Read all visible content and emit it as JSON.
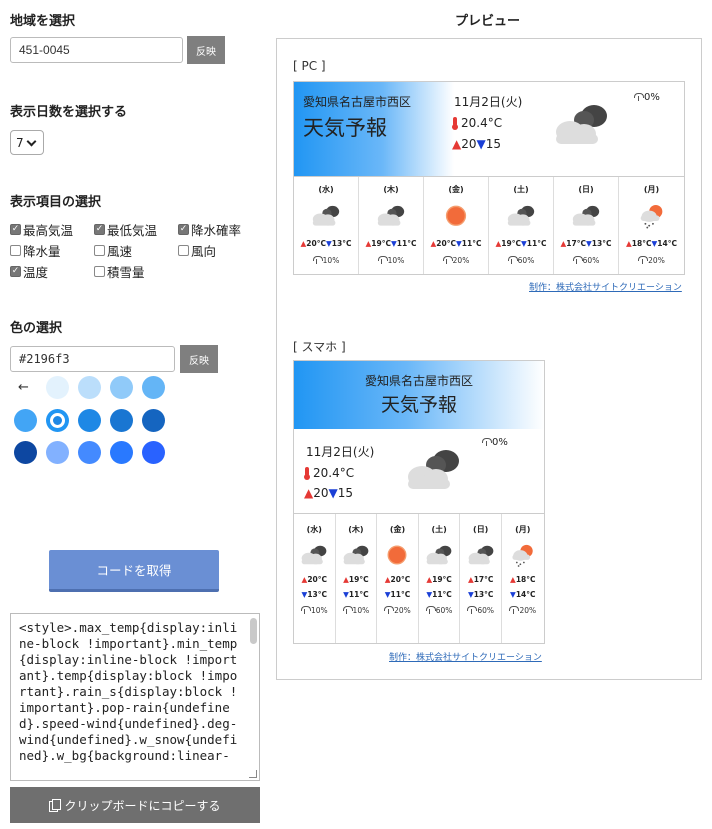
{
  "left": {
    "region": {
      "title": "地域を選択",
      "value": "451-0045",
      "button": "反映"
    },
    "days": {
      "title": "表示日数を選択する",
      "selected": "7"
    },
    "items": {
      "title": "表示項目の選択",
      "options": [
        {
          "label": "最高気温",
          "checked": true
        },
        {
          "label": "最低気温",
          "checked": true
        },
        {
          "label": "降水確率",
          "checked": true
        },
        {
          "label": "降水量",
          "checked": false
        },
        {
          "label": "風速",
          "checked": false
        },
        {
          "label": "風向",
          "checked": false
        },
        {
          "label": "温度",
          "checked": true
        },
        {
          "label": "積雪量",
          "checked": false
        }
      ]
    },
    "color": {
      "title": "色の選択",
      "value": "#2196f3",
      "button": "反映",
      "swatches": [
        "#e3f2fd",
        "#bbdefb",
        "#90caf9",
        "#64b5f6",
        "#42a5f5",
        "#2196f3",
        "#1e88e5",
        "#1976d2",
        "#1565c0",
        "#0d47a1",
        "#82b1ff",
        "#448aff",
        "#2979ff",
        "#2962ff"
      ],
      "selected_index": 5
    },
    "get_code": "コードを取得",
    "code": "<style>.max_temp{display:inline-block !important}.min_temp{display:inline-block !important}.temp{display:block !important}.rain_s{display:block !important}.pop-rain{undefined}.speed-wind{undefined}.deg-wind{undefined}.w_snow{undefined}.w_bg{background:linear-",
    "copy": "クリップボードにコピーする"
  },
  "preview": {
    "title": "プレビュー",
    "pc_label": "[ PC ]",
    "sp_label": "[ スマホ ]",
    "location": "愛知県名古屋市西区",
    "heading": "天気予報",
    "date": "11月2日(火)",
    "temp": "20.4°C",
    "high": "20",
    "low": "15",
    "pop": "0%",
    "credit": "制作：株式会社サイトクリエーション",
    "days": [
      {
        "wd": "(水)",
        "icon": "cloudy",
        "hi": "20°C",
        "lo": "13°C",
        "pop": "10%"
      },
      {
        "wd": "(木)",
        "icon": "cloudy",
        "hi": "19°C",
        "lo": "11°C",
        "pop": "10%"
      },
      {
        "wd": "(金)",
        "icon": "sun",
        "hi": "20°C",
        "lo": "11°C",
        "pop": "20%"
      },
      {
        "wd": "(土)",
        "icon": "cloudy",
        "hi": "19°C",
        "lo": "11°C",
        "pop": "60%"
      },
      {
        "wd": "(日)",
        "icon": "cloudy",
        "hi": "17°C",
        "lo": "13°C",
        "pop": "60%"
      },
      {
        "wd": "(月)",
        "icon": "rain-sun",
        "hi": "18°C",
        "lo": "14°C",
        "pop": "20%"
      }
    ]
  }
}
